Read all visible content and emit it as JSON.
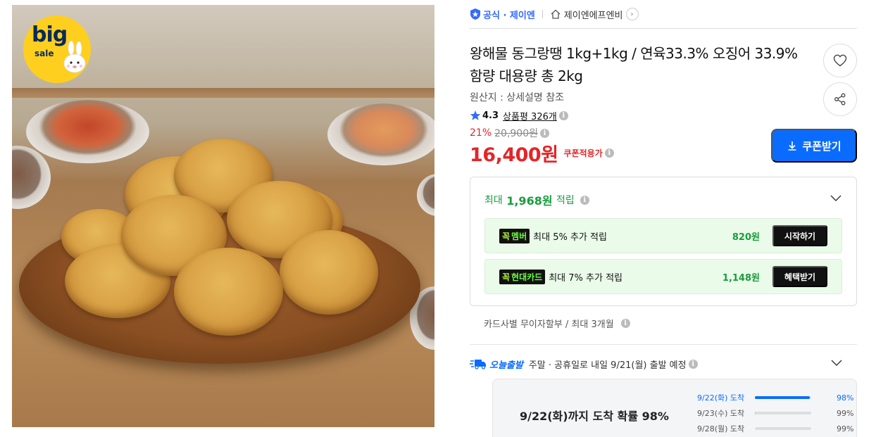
{
  "image": {
    "badge": {
      "big": "big",
      "sale": "sale"
    }
  },
  "brand": {
    "official_label": "공식 · 제이엔",
    "store_name": "제이엔에프엔비",
    "chevron": "›"
  },
  "product": {
    "title": "왕해물 동그랑땡 1kg+1kg / 연육33.3% 오징어 33.9% 함량 대용량 총 2kg",
    "origin": "원산지 : 상세설명 참조",
    "rating": "4.3",
    "review_label": "상품평 326개",
    "discount_rate": "21%",
    "original_price": "20,900원",
    "sale_price": "16,400원",
    "coupon_price_label": "쿠폰적용가",
    "info_glyph": "i"
  },
  "coupon_button": {
    "label": "쿠폰받기"
  },
  "rewards": {
    "header_prefix": "최대",
    "header_amount": "1,968원",
    "header_suffix": "적립",
    "rows": [
      {
        "tag_prefix": "꼭",
        "tag_label": "멤버",
        "text": "최대 5% 추가 적립",
        "amount": "820원",
        "action": "시작하기"
      },
      {
        "tag_prefix": "꼭",
        "tag_label": "현대카드",
        "text": "최대 7% 추가 적립",
        "amount": "1,148원",
        "action": "혜택받기"
      }
    ]
  },
  "installment": {
    "text": "카드사별 무이자할부 / 최대 3개월"
  },
  "shipping": {
    "brand": "오늘출발",
    "text": "주말 · 공휴일로 내일 9/21(월) 출발 예정"
  },
  "forecast": {
    "headline": "9/22(화)까지 도착 확률 98%",
    "lines": [
      {
        "date": "9/22(화) 도착",
        "percent": "98%",
        "fraction": 0.98,
        "active": true
      },
      {
        "date": "9/23(수) 도착",
        "percent": "99%",
        "fraction": 0.01,
        "active": false
      },
      {
        "date": "9/28(월) 도착",
        "percent": "99%",
        "fraction": 0.0,
        "active": false
      }
    ]
  },
  "colors": {
    "accent_blue": "#0a6cff",
    "sale_red": "#e52528",
    "reward_green": "#1a9c3e"
  },
  "icons": [
    "shield-icon",
    "home-icon",
    "heart-icon",
    "share-icon",
    "star-icon",
    "download-icon",
    "chevron-down-icon",
    "truck-icon",
    "bunny-icon"
  ]
}
